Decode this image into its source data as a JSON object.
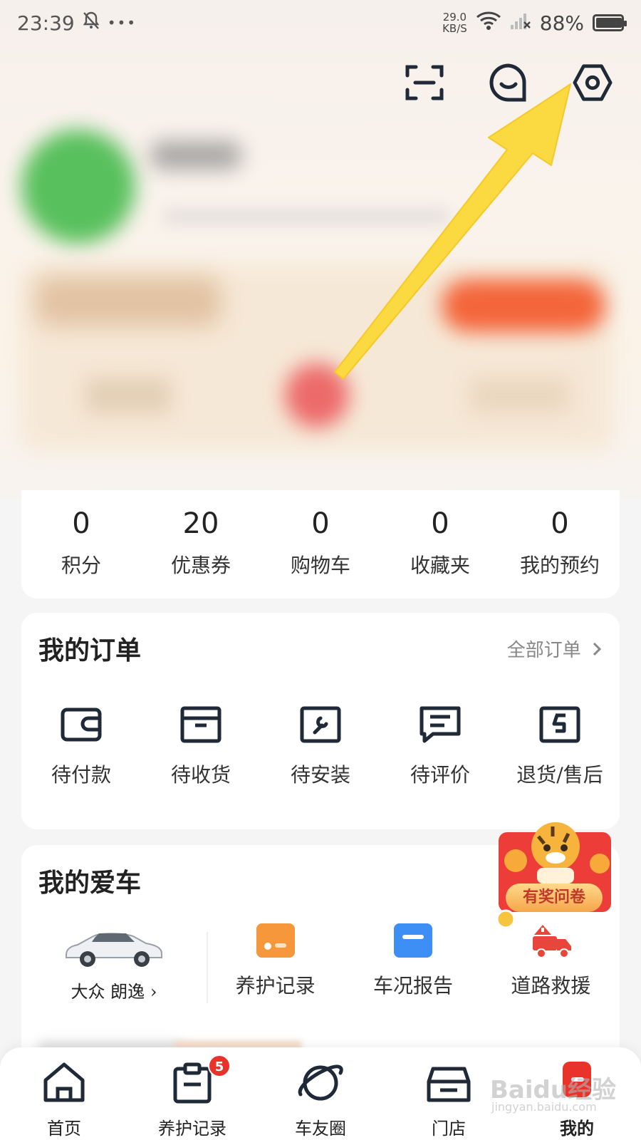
{
  "status_bar": {
    "time": "23:39",
    "dots": "•••",
    "net_speed_value": "29.0",
    "net_speed_unit": "KB/S",
    "battery": "88%"
  },
  "header_icons": [
    "scan-icon",
    "message-icon",
    "settings-icon"
  ],
  "stats": [
    {
      "value": "0",
      "label": "积分"
    },
    {
      "value": "20",
      "label": "优惠券"
    },
    {
      "value": "0",
      "label": "购物车"
    },
    {
      "value": "0",
      "label": "收藏夹"
    },
    {
      "value": "0",
      "label": "我的预约"
    }
  ],
  "orders": {
    "title": "我的订单",
    "all_link": "全部订单",
    "items": [
      {
        "label": "待付款",
        "icon": "wallet-icon"
      },
      {
        "label": "待收货",
        "icon": "box-icon"
      },
      {
        "label": "待安装",
        "icon": "wrench-icon"
      },
      {
        "label": "待评价",
        "icon": "comment-icon"
      },
      {
        "label": "退货/售后",
        "icon": "return-icon"
      }
    ]
  },
  "car": {
    "title": "我的爱车",
    "car_name": "大众 朗逸",
    "features": [
      {
        "label": "养护记录",
        "icon": "maintenance-icon"
      },
      {
        "label": "车况报告",
        "icon": "report-icon"
      },
      {
        "label": "道路救援",
        "icon": "tow-truck-icon"
      }
    ]
  },
  "promo": {
    "label": "有奖问卷"
  },
  "tabs": [
    {
      "label": "首页",
      "icon": "home-icon"
    },
    {
      "label": "养护记录",
      "icon": "clipboard-icon",
      "badge": "5"
    },
    {
      "label": "车友圈",
      "icon": "planet-icon"
    },
    {
      "label": "门店",
      "icon": "store-icon"
    },
    {
      "label": "我的",
      "icon": "profile-icon",
      "active": true
    }
  ],
  "watermark": {
    "text": "Baidu经验",
    "sub": "jingyan.baidu.com"
  },
  "colors": {
    "accent": "#e8322a",
    "orange": "#f5973a",
    "blue": "#3d8ef5",
    "arrow": "#fbd940",
    "icon_dark": "#1f2937"
  }
}
